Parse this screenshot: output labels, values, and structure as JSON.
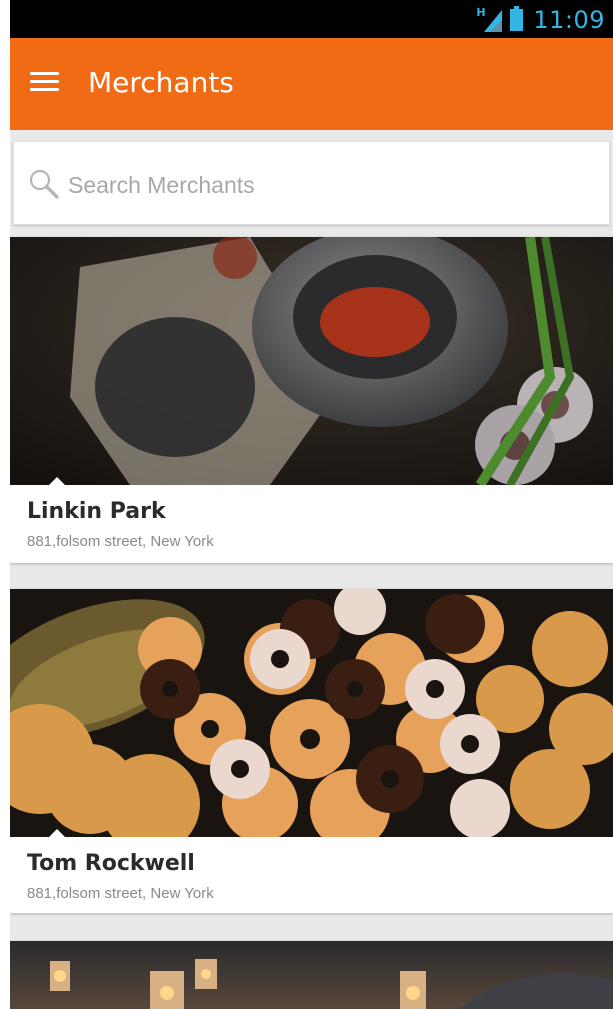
{
  "status_bar": {
    "network": "H",
    "time": "11:09"
  },
  "toolbar": {
    "title": "Merchants",
    "menu_icon": "hamburger-menu-icon"
  },
  "search": {
    "placeholder": "Search Merchants",
    "value": "",
    "icon": "search-icon"
  },
  "merchants": [
    {
      "name": "Linkin Park",
      "address": "881,folsom street, New York",
      "image": "spices-mortar-photo"
    },
    {
      "name": "Tom Rockwell",
      "address": "881,folsom street, New York",
      "image": "donuts-cookies-photo"
    },
    {
      "name": "",
      "address": "",
      "image": "evening-lanterns-photo"
    }
  ],
  "colors": {
    "primary": "#f16b14",
    "status_accent": "#33b5e5"
  }
}
